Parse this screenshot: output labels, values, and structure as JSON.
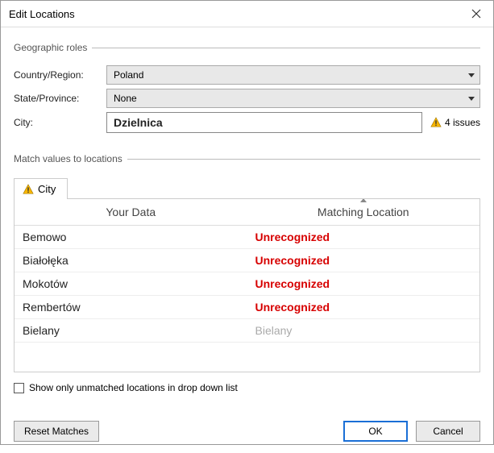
{
  "title": "Edit Locations",
  "geo": {
    "legend": "Geographic roles",
    "country_label": "Country/Region:",
    "country_value": "Poland",
    "state_label": "State/Province:",
    "state_value": "None",
    "city_label": "City:",
    "city_value": "Dzielnica",
    "issues_text": "4 issues"
  },
  "match": {
    "legend": "Match values to locations",
    "tab_label": "City",
    "col_your": "Your Data",
    "col_match": "Matching Location",
    "rows": [
      {
        "your": "Bemowo",
        "match": "Unrecognized",
        "recognized": false
      },
      {
        "your": "Białołęka",
        "match": "Unrecognized",
        "recognized": false
      },
      {
        "your": "Mokotów",
        "match": "Unrecognized",
        "recognized": false
      },
      {
        "your": "Rembertów",
        "match": "Unrecognized",
        "recognized": false
      },
      {
        "your": "Bielany",
        "match": "Bielany",
        "recognized": true
      }
    ],
    "show_unmatched_label": "Show only unmatched locations in drop down list",
    "show_unmatched_checked": false
  },
  "buttons": {
    "reset": "Reset Matches",
    "ok": "OK",
    "cancel": "Cancel"
  },
  "colors": {
    "error": "#d70000",
    "primary": "#1a6fd6"
  }
}
